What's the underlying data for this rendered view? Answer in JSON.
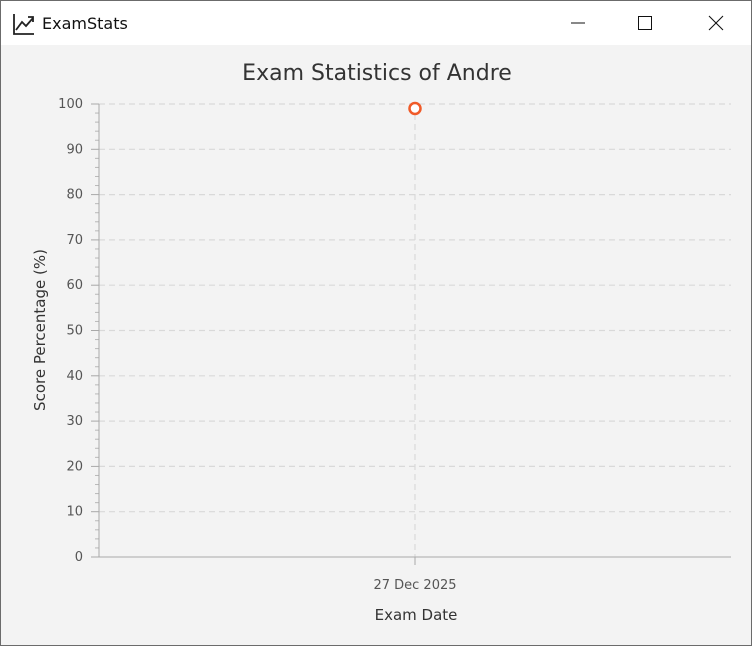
{
  "window": {
    "title": "ExamStats",
    "icon": "line-chart-icon"
  },
  "chart_data": {
    "type": "scatter",
    "title": "Exam Statistics of Andre",
    "xlabel": "Exam Date",
    "ylabel": "Score Percentage (%)",
    "ylim": [
      0,
      100
    ],
    "y_ticks": [
      0,
      10,
      20,
      30,
      40,
      50,
      60,
      70,
      80,
      90,
      100
    ],
    "x_tick_labels": [
      "27 Dec 2025"
    ],
    "points": [
      {
        "x": "27 Dec 2025",
        "y": 99
      }
    ],
    "grid": true,
    "marker_color": "#f05a28"
  }
}
